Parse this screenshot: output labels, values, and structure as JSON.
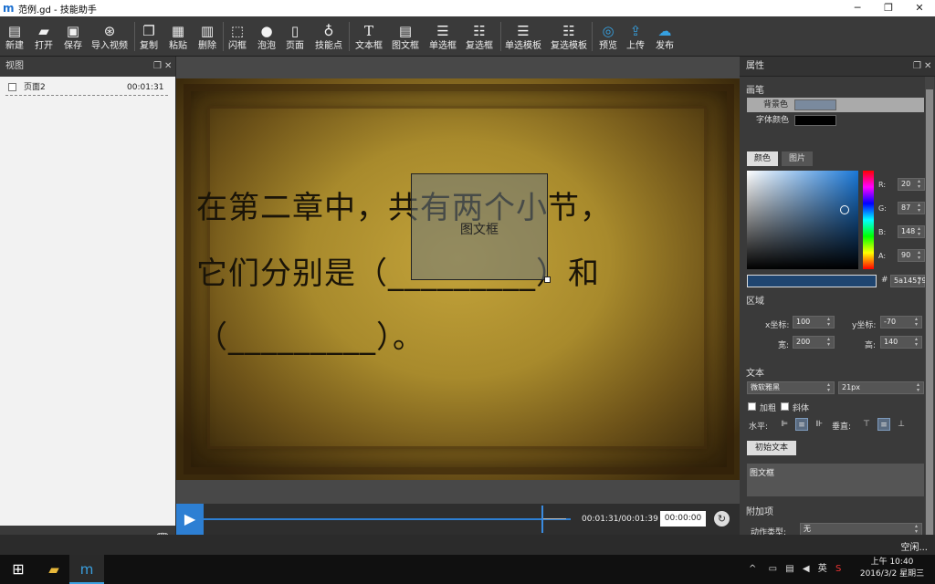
{
  "window": {
    "logo": "m",
    "title": "范例.gd - 技能助手",
    "minimize": "─",
    "maximize": "❐",
    "close": "✕"
  },
  "toolbar": {
    "new": "新建",
    "open": "打开",
    "save": "保存",
    "import_video": "导入视频",
    "copy": "复制",
    "paste": "粘贴",
    "delete": "删除",
    "flash_box": "闪框",
    "bubble": "泡泡",
    "page": "页面",
    "skill_point": "技能点",
    "text_box": "文本框",
    "image_text_box": "图文框",
    "single_choice": "单选框",
    "multi_choice": "复选框",
    "single_template": "单选模板",
    "multi_template": "复选模板",
    "preview": "预览",
    "upload": "上传",
    "publish": "发布"
  },
  "left_panel": {
    "title": "视图",
    "pages": [
      {
        "name": "页面2",
        "time": "00:01:31"
      }
    ]
  },
  "canvas": {
    "line1": "在第二章中，共有两个小节，",
    "line2": "它们分别是（_________）和",
    "line3": "（_________）。",
    "textbox_label": "图文框"
  },
  "timeline": {
    "time": "00:01:31/00:01:39",
    "input": "00:00:00",
    "progress": 0.92
  },
  "properties": {
    "title": "属性",
    "brush": "画笔",
    "bg_color_label": "背景色",
    "bg_color": "#7a8a9e",
    "font_color_label": "字体颜色",
    "font_color": "#000000",
    "tab_color": "颜色",
    "tab_image": "图片",
    "r_label": "R:",
    "g_label": "G:",
    "b_label": "B:",
    "a_label": "A:",
    "r": "20",
    "g": "87",
    "b": "148",
    "a": "90",
    "hex_label": "#",
    "hex": "5a14579",
    "region": "区域",
    "x_label": "x坐标:",
    "x": "100",
    "y_label": "y坐标:",
    "y": "-70",
    "w_label": "宽:",
    "w": "200",
    "h_label": "高:",
    "h": "140",
    "text_section": "文本",
    "font": "微软雅黑",
    "size": "21px",
    "bold": "加粗",
    "italic": "斜体",
    "h_align": "水平:",
    "v_align": "垂直:",
    "init_text_button": "初始文本",
    "text_value": "图文框",
    "addon": "附加项",
    "action_type_label": "动作类型:",
    "action_type": "无"
  },
  "status": {
    "text": "空闲..."
  },
  "taskbar": {
    "tray_lang": "英",
    "time": "上午 10:40",
    "date": "2016/3/2 星期三"
  }
}
